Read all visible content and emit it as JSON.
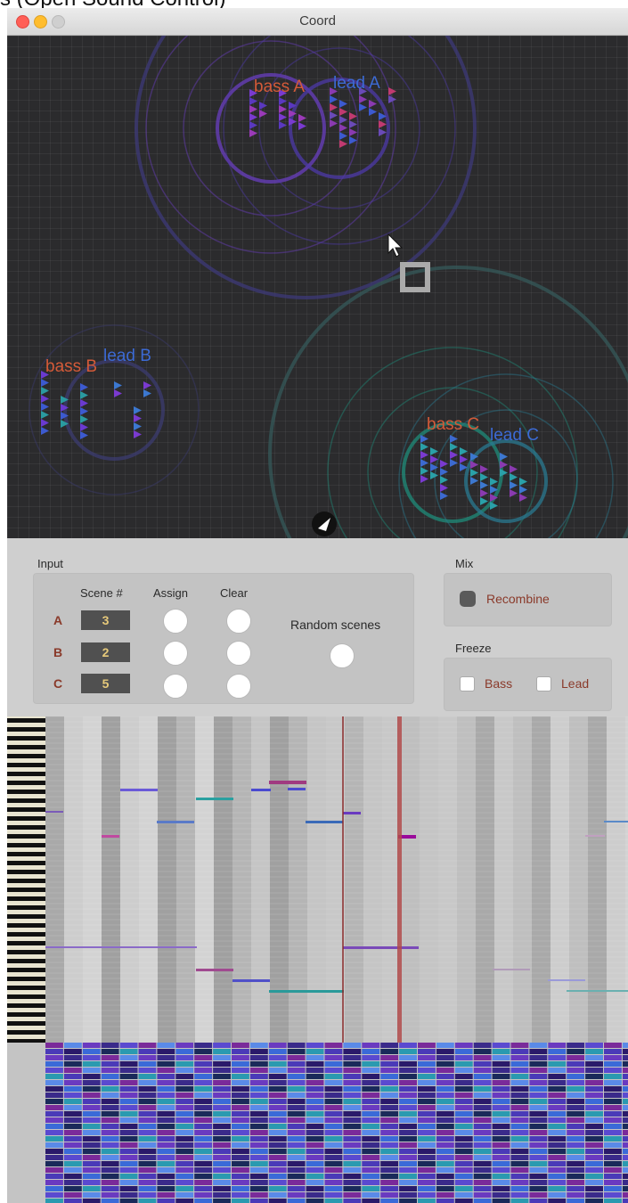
{
  "header_fragment": "s (Open Sound Control)",
  "window": {
    "title": "Coord"
  },
  "canvas": {
    "voices": [
      {
        "label": "bass A",
        "color": "#d45a38"
      },
      {
        "label": "lead A",
        "color": "#3c6ad4"
      },
      {
        "label": "bass B",
        "color": "#d45a38"
      },
      {
        "label": "lead B",
        "color": "#3c6ad4"
      },
      {
        "label": "bass C",
        "color": "#d45a38"
      },
      {
        "label": "lead C",
        "color": "#3c6ad4"
      }
    ]
  },
  "input": {
    "title": "Input",
    "columns": {
      "scene": "Scene #",
      "assign": "Assign",
      "clear": "Clear"
    },
    "rows": [
      {
        "label": "A",
        "scene": "3"
      },
      {
        "label": "B",
        "scene": "2"
      },
      {
        "label": "C",
        "scene": "5"
      }
    ],
    "random_label": "Random scenes"
  },
  "mix": {
    "title": "Mix",
    "recombine_label": "Recombine"
  },
  "freeze": {
    "title": "Freeze",
    "bass_label": "Bass",
    "lead_label": "Lead"
  },
  "colors": {
    "bass": "#d45a38",
    "lead": "#3c6ad4",
    "panel": "#cfcfcf",
    "canvas": "#2b2b2d",
    "playhead": "#a03030"
  }
}
